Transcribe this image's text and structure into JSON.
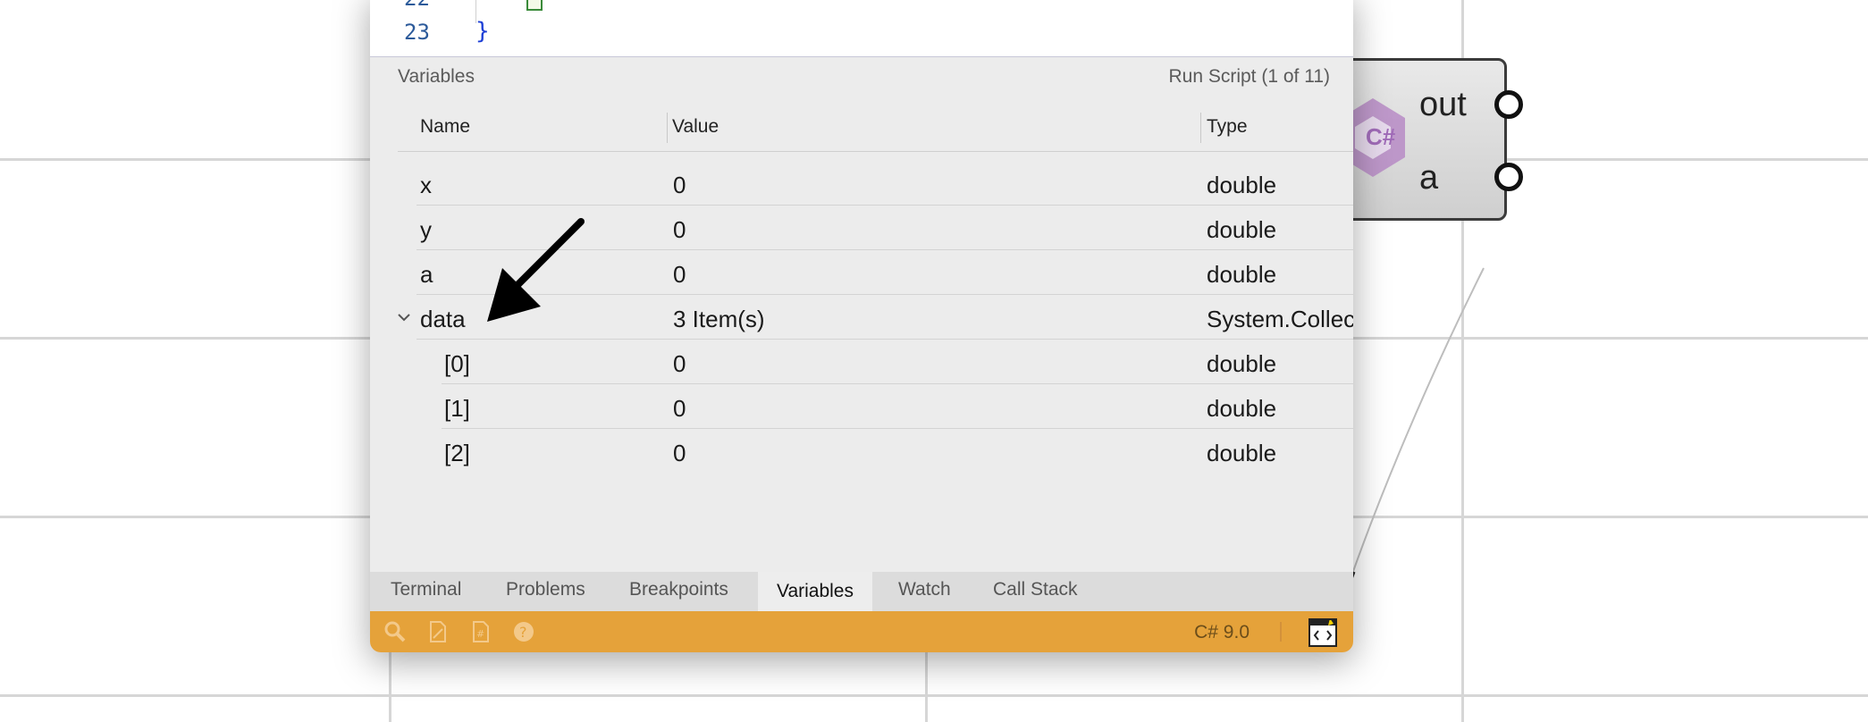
{
  "code_editor": {
    "lines": [
      {
        "number": "22",
        "text": ""
      },
      {
        "number": "23",
        "text": "}"
      }
    ]
  },
  "debug_panel": {
    "title": "Variables",
    "run_status": "Run Script (1 of 11)",
    "columns": {
      "name": "Name",
      "value": "Value",
      "type": "Type"
    },
    "rows": [
      {
        "name": "x",
        "value": "0",
        "type": "double"
      },
      {
        "name": "y",
        "value": "0",
        "type": "double"
      },
      {
        "name": "a",
        "value": "0",
        "type": "double"
      },
      {
        "name": "data",
        "value": "3 Item(s)",
        "type": "System.Collec"
      },
      {
        "name": "[0]",
        "value": "0",
        "type": "double"
      },
      {
        "name": "[1]",
        "value": "0",
        "type": "double"
      },
      {
        "name": "[2]",
        "value": "0",
        "type": "double"
      }
    ]
  },
  "tabs": [
    {
      "label": "Terminal"
    },
    {
      "label": "Problems"
    },
    {
      "label": "Breakpoints"
    },
    {
      "label": "Variables",
      "active": true
    },
    {
      "label": "Watch"
    },
    {
      "label": "Call Stack"
    }
  ],
  "statusbar": {
    "language": "C# 9.0",
    "icons": [
      "search-icon",
      "document-icon",
      "csharp-file-icon",
      "help-icon",
      "code-window-icon"
    ],
    "color": "#e5a23a"
  },
  "gh_component": {
    "logo_text": "C#",
    "outputs": [
      {
        "label": "out"
      },
      {
        "label": "a"
      }
    ]
  }
}
